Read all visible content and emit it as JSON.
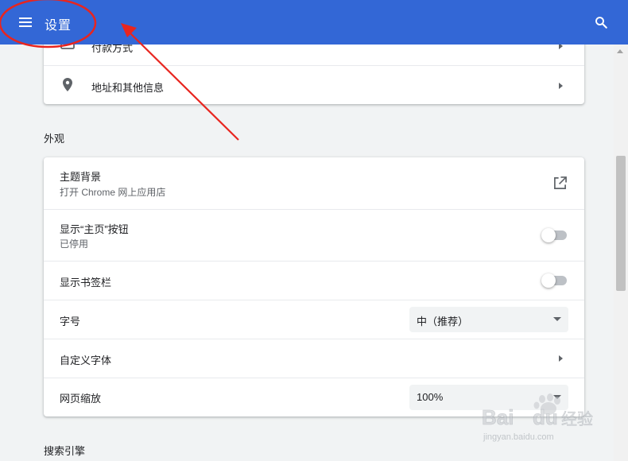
{
  "header": {
    "title": "设置",
    "menu_icon": "hamburger-menu-icon",
    "search_icon": "search-icon",
    "color": "#3367d6"
  },
  "autofill_card": {
    "rows": [
      {
        "label": "付款方式",
        "icon": "credit-card-icon"
      },
      {
        "label": "地址和其他信息",
        "icon": "location-pin-icon"
      }
    ]
  },
  "appearance": {
    "section_title": "外观",
    "theme": {
      "label": "主题背景",
      "sub": "打开 Chrome 网上应用店",
      "icon": "open-in-new-icon"
    },
    "home_button": {
      "label": "显示“主页”按钮",
      "sub": "已停用",
      "enabled": false
    },
    "bookmarks_bar": {
      "label": "显示书签栏",
      "enabled": false
    },
    "font_size": {
      "label": "字号",
      "value": "中（推荐）"
    },
    "custom_fonts": {
      "label": "自定义字体"
    },
    "page_zoom": {
      "label": "网页缩放",
      "value": "100%"
    }
  },
  "search_engine": {
    "section_title": "搜索引擎"
  },
  "watermark": {
    "text": "Baidu经验",
    "url": "jingyan.baidu.com"
  },
  "annotation": {
    "color": "#e8251f"
  }
}
